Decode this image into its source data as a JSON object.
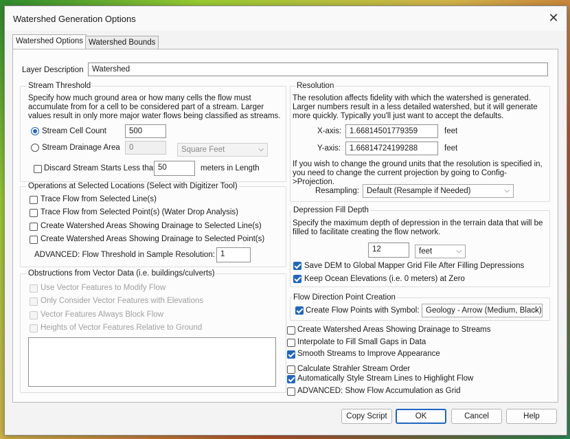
{
  "window": {
    "title": "Watershed Generation Options",
    "close_glyph": "✕"
  },
  "tabs": [
    {
      "label": "Watershed Options",
      "active": true
    },
    {
      "label": "Watershed Bounds",
      "active": false
    }
  ],
  "layer": {
    "label": "Layer Description",
    "value": "Watershed"
  },
  "stream": {
    "title": "Stream Threshold",
    "desc": "Specify how much ground area or how many cells the flow must accumulate from for a cell to be considered part of a stream. Larger values result in only more major water flows being classified as streams.",
    "cell_count_label": "Stream Cell Count",
    "cell_count_value": "500",
    "drainage_label": "Stream Drainage Area",
    "drainage_value": "0",
    "drainage_unit": "Square Feet",
    "discard_label": "Discard Stream Starts Less than",
    "discard_value": "50",
    "discard_unit": "meters in Length"
  },
  "ops": {
    "title": "Operations at Selected Locations (Select with Digitizer Tool)",
    "items": [
      "Trace Flow from Selected Line(s)",
      "Trace Flow from Selected Point(s) (Water Drop Analysis)",
      "Create Watershed Areas Showing Drainage to Selected Line(s)",
      "Create Watershed Areas Showing Drainage to Selected Point(s)"
    ],
    "advanced_label": "ADVANCED: Flow Threshold in Sample Resolution:",
    "advanced_value": "1"
  },
  "obstructions": {
    "title": "Obstructions from Vector Data (i.e. buildings/culverts)",
    "items": [
      "Use Vector Features to Modify Flow",
      "Only Consider Vector Features with Elevations",
      "Vector Features Always Block Flow",
      "Heights of Vector Features Relative to Ground"
    ]
  },
  "resolution": {
    "title": "Resolution",
    "desc": "The resolution affects fidelity with which the watershed is generated. Larger numbers result in a less detailed watershed, but it will generate more quickly. Typically you'll just want to accept the defaults.",
    "x_label": "X-axis:",
    "x_value": "1.66814501779359",
    "y_label": "Y-axis:",
    "y_value": "1.66814724199288",
    "unit": "feet",
    "note": "If you wish to change the ground units that the resolution is specified in, you need to change the current projection by going to Config->Projection.",
    "resampling_label": "Resampling:",
    "resampling_value": "Default (Resample if Needed)"
  },
  "depression": {
    "title": "Depression Fill Depth",
    "desc": "Specify the maximum depth of depression in the terrain data that will be filled to facilitate creating the flow network.",
    "value": "12",
    "unit": "feet",
    "save_dem_label": "Save DEM to Global Mapper Grid File After Filling Depressions",
    "keep_ocean_label": "Keep Ocean Elevations (i.e. 0 meters) at Zero"
  },
  "flowpoint": {
    "title": "Flow Direction Point Creation",
    "create_label": "Create Flow Points with Symbol:",
    "symbol_value": "Geology - Arrow (Medium, Black)"
  },
  "options": [
    {
      "label": "Create Watershed Areas Showing Drainage to Streams",
      "checked": false
    },
    {
      "label": "Interpolate to Fill Small Gaps in Data",
      "checked": false
    },
    {
      "label": "Smooth Streams to Improve Appearance",
      "checked": true
    },
    {
      "label": "Calculate Strahler Stream Order",
      "checked": false
    },
    {
      "label": "Automatically Style Stream Lines to Highlight Flow",
      "checked": true
    },
    {
      "label": "ADVANCED: Show Flow Accumulation as Grid",
      "checked": false
    }
  ],
  "buttons": {
    "copy_script": "Copy Script",
    "ok": "OK",
    "cancel": "Cancel",
    "help": "Help"
  },
  "colors": {
    "accent": "#1f66c1",
    "dialog_bg": "#f3f3f3"
  }
}
